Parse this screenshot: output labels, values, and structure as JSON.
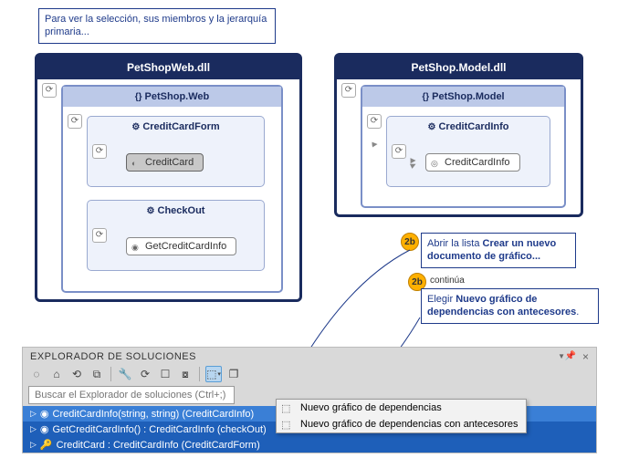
{
  "hint_top": "Para ver la selección, sus miembros y la jerarquía primaria...",
  "assemblies": {
    "web": {
      "title": "PetShopWeb.dll",
      "ns": {
        "title": "PetShop.Web",
        "cls1": {
          "title": "CreditCardForm",
          "member": "CreditCard"
        },
        "cls2": {
          "title": "CheckOut",
          "member": "GetCreditCardInfo"
        }
      }
    },
    "model": {
      "title": "PetShop.Model.dll",
      "ns": {
        "title": "PetShop.Model",
        "cls": {
          "title": "CreditCardInfo",
          "member": "CreditCardInfo"
        }
      }
    }
  },
  "annot": {
    "open_pre": "Abrir la lista ",
    "open_bold": "Crear un nuevo documento de gráfico...",
    "cont": "continúa",
    "choose_pre": "Elegir ",
    "choose_bold": "Nuevo gráfico de dependencias con antecesores",
    "period": ".",
    "badge": "2b"
  },
  "se": {
    "title": "EXPLORADOR DE SOLUCIONES",
    "search_ph": "Buscar el Explorador de soluciones (Ctrl+;)",
    "menu": {
      "item1": "Nuevo gráfico de dependencias",
      "item2": "Nuevo gráfico de dependencias con antecesores"
    },
    "rows": {
      "r1": "CreditCardInfo(string, string) (CreditCardInfo)",
      "r2": "GetCreditCardInfo() : CreditCardInfo (checkOut)",
      "r3": "CreditCard : CreditCardInfo (CreditCardForm)"
    }
  }
}
